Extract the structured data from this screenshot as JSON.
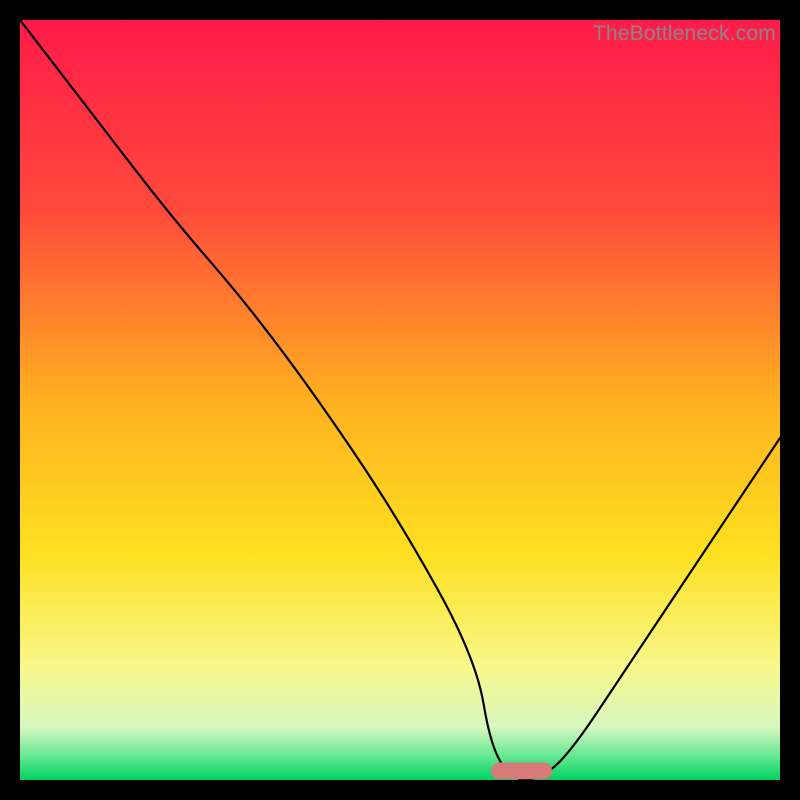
{
  "watermark": "TheBottleneck.com",
  "chart_data": {
    "type": "line",
    "title": "",
    "xlabel": "",
    "ylabel": "",
    "xlim": [
      0,
      100
    ],
    "ylim": [
      0,
      100
    ],
    "grid": false,
    "legend": false,
    "curve": {
      "name": "bottleneck-curve",
      "x": [
        0,
        10,
        20,
        30,
        40,
        50,
        60,
        62,
        65,
        68,
        72,
        80,
        90,
        100
      ],
      "y": [
        100,
        87,
        74,
        62.5,
        49,
        34,
        16,
        4,
        0,
        0,
        3,
        15,
        30,
        45
      ]
    },
    "gradient_stops": [
      {
        "offset": 0.0,
        "color": "#ff1a4a"
      },
      {
        "offset": 0.25,
        "color": "#ff4a3a"
      },
      {
        "offset": 0.5,
        "color": "#ffb020"
      },
      {
        "offset": 0.7,
        "color": "#ffe020"
      },
      {
        "offset": 0.85,
        "color": "#f8f88a"
      },
      {
        "offset": 0.93,
        "color": "#d8f8c0"
      },
      {
        "offset": 0.97,
        "color": "#60e890"
      },
      {
        "offset": 1.0,
        "color": "#00d060"
      }
    ],
    "marker": {
      "x_start": 62,
      "x_end": 70,
      "y": 1.2,
      "color": "#d77a7a",
      "height": 2.2
    }
  }
}
